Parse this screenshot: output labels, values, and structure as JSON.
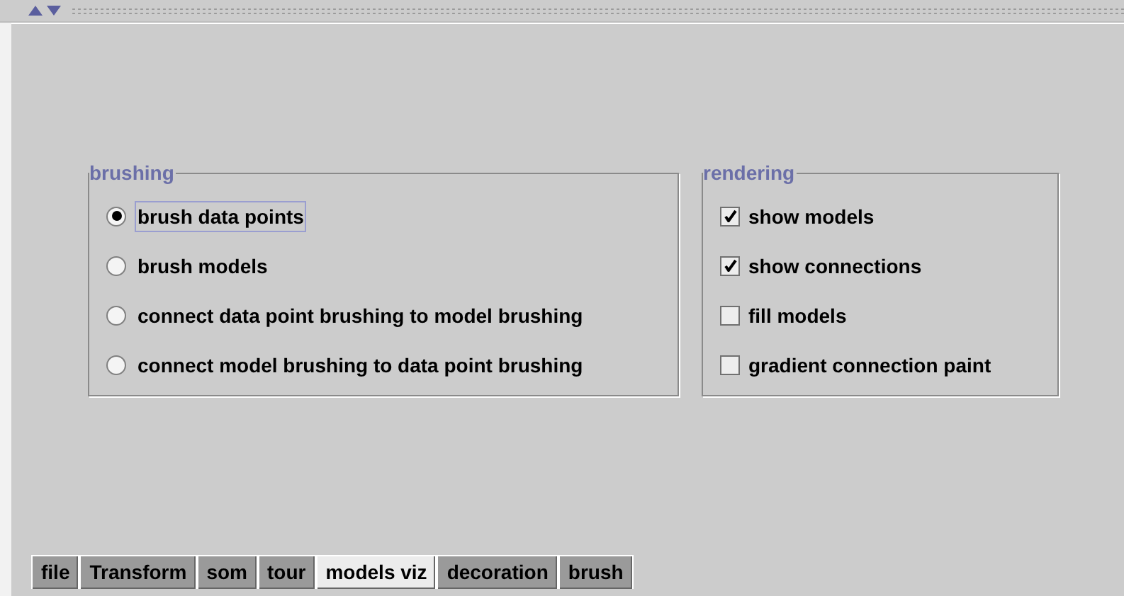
{
  "brushing": {
    "title": "brushing",
    "options": [
      {
        "label": "brush data points",
        "selected": true,
        "focused": true
      },
      {
        "label": "brush models",
        "selected": false,
        "focused": false
      },
      {
        "label": "connect data point brushing to model brushing",
        "selected": false,
        "focused": false
      },
      {
        "label": "connect model brushing to data point brushing",
        "selected": false,
        "focused": false
      }
    ]
  },
  "rendering": {
    "title": "rendering",
    "options": [
      {
        "label": "show models",
        "checked": true
      },
      {
        "label": "show connections",
        "checked": true
      },
      {
        "label": "fill models",
        "checked": false
      },
      {
        "label": "gradient connection paint",
        "checked": false
      }
    ]
  },
  "tabs": [
    {
      "label": "file",
      "selected": false
    },
    {
      "label": "Transform",
      "selected": false
    },
    {
      "label": "som",
      "selected": false
    },
    {
      "label": "tour",
      "selected": false
    },
    {
      "label": "models viz",
      "selected": true
    },
    {
      "label": "decoration",
      "selected": false
    },
    {
      "label": "brush",
      "selected": false
    }
  ]
}
